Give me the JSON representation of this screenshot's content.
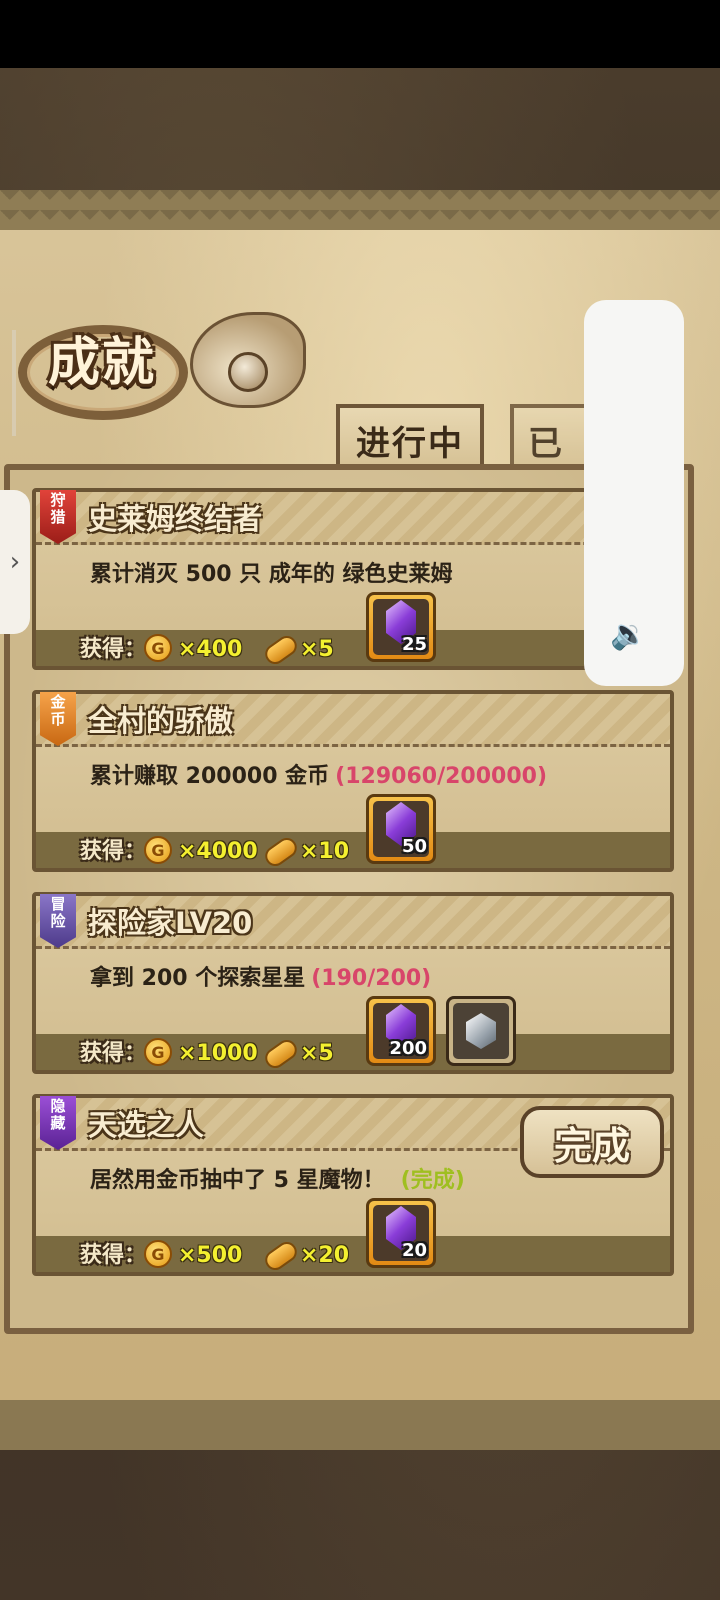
{
  "header": {
    "title": "成就"
  },
  "tabs": [
    {
      "label": "进行中",
      "active": true
    },
    {
      "label": "已",
      "active": false
    }
  ],
  "reward_label": "获得：",
  "coin_symbol": "G",
  "achievements": [
    {
      "badge": "狩\n猎",
      "badge_color": "red",
      "title": "史莱姆终结者",
      "description": "累计消灭 500 只 成年的 绿色史莱姆",
      "progress": "",
      "coins": "×400",
      "bread": "×5",
      "gem_count": "25",
      "extra_item": false,
      "completed": false
    },
    {
      "badge": "金\n币",
      "badge_color": "orange",
      "title": "全村的骄傲",
      "description": "累计赚取 200000 金币",
      "progress": "(129060/200000)",
      "coins": "×4000",
      "bread": "×10",
      "gem_count": "50",
      "extra_item": false,
      "completed": false
    },
    {
      "badge": "冒\n险",
      "badge_color": "purple",
      "title": "探险家LV20",
      "description": "拿到 200 个探索星星",
      "progress": "(190/200)",
      "coins": "×1000",
      "bread": "×5",
      "gem_count": "200",
      "extra_item": true,
      "completed": false
    },
    {
      "badge": "隐\n藏",
      "badge_color": "violet",
      "title": "天选之人",
      "description": "居然用金币抽中了 5 星魔物！",
      "progress": "(完成)",
      "coins": "×500",
      "bread": "×20",
      "gem_count": "20",
      "extra_item": false,
      "completed": true,
      "complete_button": "完成"
    }
  ],
  "side_handle_icon": "›",
  "volume_icon": "🔉"
}
